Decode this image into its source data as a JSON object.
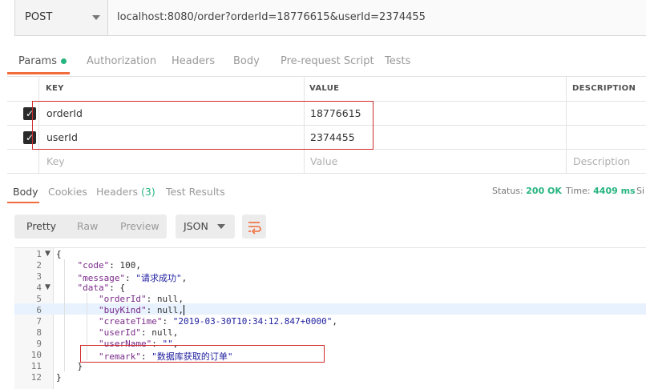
{
  "request": {
    "method": "POST",
    "url": "localhost:8080/order?orderId=18776615&userId=2374455"
  },
  "request_tabs": [
    {
      "label": "Params"
    },
    {
      "label": "Authorization"
    },
    {
      "label": "Headers"
    },
    {
      "label": "Body"
    },
    {
      "label": "Pre-request Script"
    },
    {
      "label": "Tests"
    }
  ],
  "params_table": {
    "headers": {
      "key": "KEY",
      "value": "VALUE",
      "description": "DESCRIPTION"
    },
    "rows": [
      {
        "key": "orderId",
        "value": "18776615",
        "checked": true
      },
      {
        "key": "userId",
        "value": "2374455",
        "checked": true
      }
    ],
    "placeholders": {
      "key": "Key",
      "value": "Value",
      "description": "Description"
    }
  },
  "response_tabs": [
    {
      "label": "Body"
    },
    {
      "label": "Cookies"
    },
    {
      "label": "Headers",
      "count": "(3)"
    },
    {
      "label": "Test Results"
    }
  ],
  "status": {
    "status_label": "Status:",
    "status_value": "200 OK",
    "time_label": "Time:",
    "time_value": "4409 ms",
    "size_label": "Si"
  },
  "view_modes": [
    "Pretty",
    "Raw",
    "Preview"
  ],
  "format": "JSON",
  "code": {
    "line_numbers": [
      "1",
      "2",
      "3",
      "4",
      "5",
      "6",
      "7",
      "8",
      "9",
      "10",
      "11",
      "12"
    ],
    "open_brace": "{",
    "code_key": "\"code\"",
    "code_val": "100",
    "message_key": "\"message\"",
    "message_val": "\"请求成功\"",
    "data_key": "\"data\"",
    "orderId_key": "\"orderId\"",
    "buyKind_key": "\"buyKind\"",
    "createTime_key": "\"createTime\"",
    "createTime_val": "\"2019-03-30T10:34:12.847+0000\"",
    "userId_key": "\"userId\"",
    "userName_key": "\"userName\"",
    "userName_val": "\"\"",
    "remark_key": "\"remark\"",
    "remark_val": "\"数据库获取的订单\"",
    "null_val": "null",
    "close_inner": "}",
    "close_outer": "}"
  }
}
